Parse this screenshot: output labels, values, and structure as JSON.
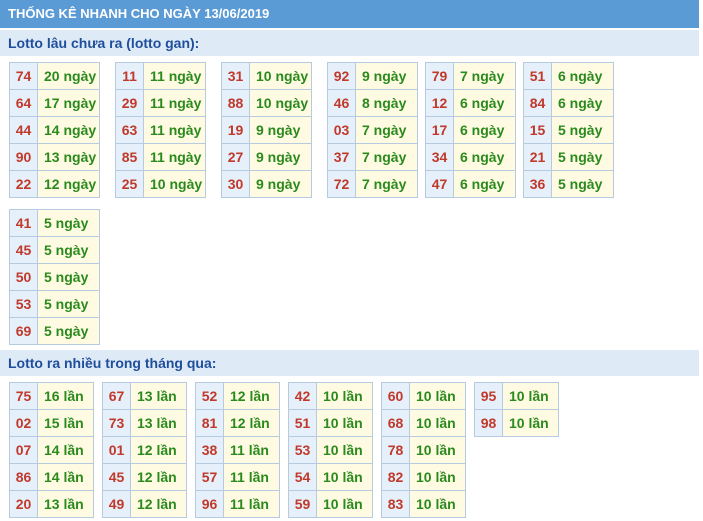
{
  "title": "THỐNG KÊ NHANH CHO NGÀY 13/06/2019",
  "sections": {
    "gan": {
      "heading": "Lotto lâu chưa ra (lotto gan):",
      "groups": [
        [
          [
            "74",
            "20 ngày"
          ],
          [
            "64",
            "17 ngày"
          ],
          [
            "44",
            "14 ngày"
          ],
          [
            "90",
            "13 ngày"
          ],
          [
            "22",
            "12 ngày"
          ]
        ],
        [
          [
            "11",
            "11 ngày"
          ],
          [
            "29",
            "11 ngày"
          ],
          [
            "63",
            "11 ngày"
          ],
          [
            "85",
            "11 ngày"
          ],
          [
            "25",
            "10 ngày"
          ]
        ],
        [
          [
            "31",
            "10 ngày"
          ],
          [
            "88",
            "10 ngày"
          ],
          [
            "19",
            "9 ngày"
          ],
          [
            "27",
            "9 ngày"
          ],
          [
            "30",
            "9 ngày"
          ]
        ],
        [
          [
            "92",
            "9 ngày"
          ],
          [
            "46",
            "8 ngày"
          ],
          [
            "03",
            "7 ngày"
          ],
          [
            "37",
            "7 ngày"
          ],
          [
            "72",
            "7 ngày"
          ]
        ],
        [
          [
            "79",
            "7 ngày"
          ],
          [
            "12",
            "6 ngày"
          ],
          [
            "17",
            "6 ngày"
          ],
          [
            "34",
            "6 ngày"
          ],
          [
            "47",
            "6 ngày"
          ]
        ],
        [
          [
            "51",
            "6 ngày"
          ],
          [
            "84",
            "6 ngày"
          ],
          [
            "15",
            "5 ngày"
          ],
          [
            "21",
            "5 ngày"
          ],
          [
            "36",
            "5 ngày"
          ]
        ],
        [
          [
            "41",
            "5 ngày"
          ],
          [
            "45",
            "5 ngày"
          ],
          [
            "50",
            "5 ngày"
          ],
          [
            "53",
            "5 ngày"
          ],
          [
            "69",
            "5 ngày"
          ]
        ]
      ]
    },
    "many": {
      "heading": "Lotto ra nhiều trong tháng qua:",
      "groups": [
        [
          [
            "75",
            "16 lần"
          ],
          [
            "02",
            "15 lần"
          ],
          [
            "07",
            "14 lần"
          ],
          [
            "86",
            "14 lần"
          ],
          [
            "20",
            "13 lần"
          ]
        ],
        [
          [
            "67",
            "13 lần"
          ],
          [
            "73",
            "13 lần"
          ],
          [
            "01",
            "12 lần"
          ],
          [
            "45",
            "12 lần"
          ],
          [
            "49",
            "12 lần"
          ]
        ],
        [
          [
            "52",
            "12 lần"
          ],
          [
            "81",
            "12 lần"
          ],
          [
            "38",
            "11 lần"
          ],
          [
            "57",
            "11 lần"
          ],
          [
            "96",
            "11 lần"
          ]
        ],
        [
          [
            "42",
            "10 lần"
          ],
          [
            "51",
            "10 lần"
          ],
          [
            "53",
            "10 lần"
          ],
          [
            "54",
            "10 lần"
          ],
          [
            "59",
            "10 lần"
          ]
        ],
        [
          [
            "60",
            "10 lần"
          ],
          [
            "68",
            "10 lần"
          ],
          [
            "78",
            "10 lần"
          ],
          [
            "82",
            "10 lần"
          ],
          [
            "83",
            "10 lần"
          ]
        ],
        [
          [
            "95",
            "10 lần"
          ],
          [
            "98",
            "10 lần"
          ]
        ]
      ]
    }
  },
  "colors": {
    "title_bg": "#5b9bd5",
    "section_bg": "#deebf7",
    "number_text": "#c0392b",
    "value_text": "#2a8a1c",
    "number_cell_bg": "#e6f0fa",
    "value_cell_bg": "#fffbe3"
  }
}
